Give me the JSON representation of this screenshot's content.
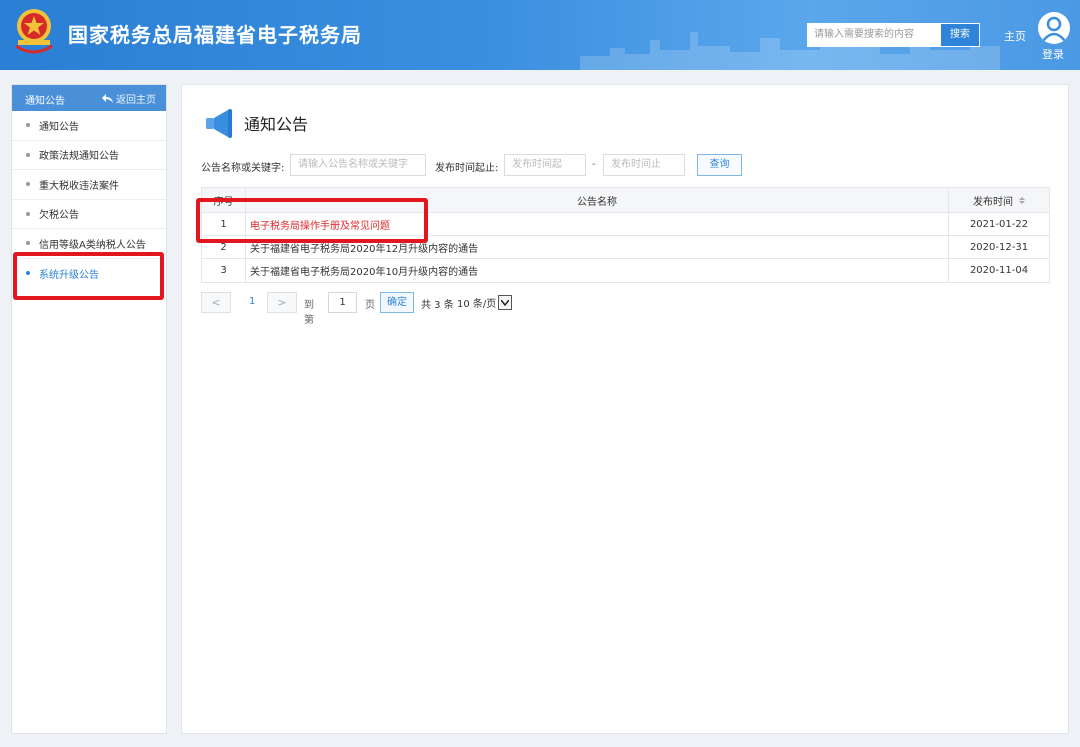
{
  "header": {
    "site_title": "国家税务总局福建省电子税务局",
    "search_placeholder": "请输入需要搜索的内容",
    "search_button": "搜索",
    "home_link": "主页",
    "login_link": "登录",
    "emblem_text": "中国税务",
    "brand_color": "#2a7fd4"
  },
  "sidebar": {
    "title": "通知公告",
    "back_label": "返回主页",
    "items": [
      {
        "label": "通知公告"
      },
      {
        "label": "政策法规通知公告"
      },
      {
        "label": "重大税收违法案件"
      },
      {
        "label": "欠税公告"
      },
      {
        "label": "信用等级A类纳税人公告"
      },
      {
        "label": "系统升级公告"
      }
    ],
    "active_index": 5
  },
  "main": {
    "title": "通知公告",
    "filter": {
      "keyword_label": "公告名称或关键字:",
      "keyword_placeholder": "请输入公告名称或关键字",
      "date_label": "发布时间起止:",
      "date_from_placeholder": "发布时间起",
      "date_separator": "-",
      "date_to_placeholder": "发布时间止",
      "query_button": "查询"
    },
    "table": {
      "columns": [
        "序号",
        "公告名称",
        "发布时间"
      ],
      "rows": [
        {
          "no": "1",
          "name": "电子税务局操作手册及常见问题",
          "date": "2021-01-22"
        },
        {
          "no": "2",
          "name": "关于福建省电子税务局2020年12月升级内容的通告",
          "date": "2020-12-31"
        },
        {
          "no": "3",
          "name": "关于福建省电子税务局2020年10月升级内容的通告",
          "date": "2020-11-04"
        }
      ]
    },
    "pagination": {
      "prev": "<",
      "current_page": "1",
      "next": ">",
      "goto_label": "到第",
      "goto_value": "1",
      "page_suffix": "页",
      "confirm": "确定",
      "total": "共 3 条",
      "per_page": "10 条/页"
    }
  },
  "highlight_color": "#e3161f"
}
